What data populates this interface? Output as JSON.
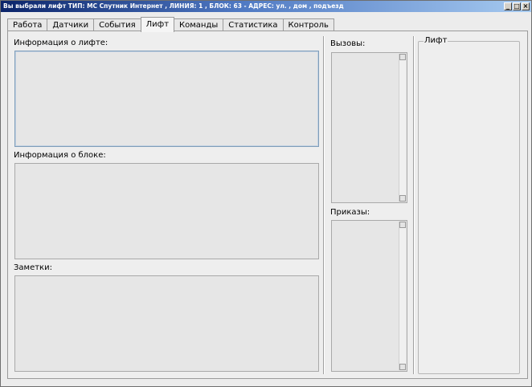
{
  "window": {
    "title": "Вы выбрали лифт  ТИП: МС Спутник Интернет , ЛИНИЯ: 1 , БЛОК: 63 - АДРЕС: ул. , дом , подъезд",
    "minimize_icon": "minimize-icon",
    "maximize_icon": "maximize-icon",
    "close_icon": "close-icon"
  },
  "tabs": [
    {
      "label": "Работа"
    },
    {
      "label": "Датчики"
    },
    {
      "label": "События"
    },
    {
      "label": "Лифт",
      "active": true
    },
    {
      "label": "Команды"
    },
    {
      "label": "Статистика"
    },
    {
      "label": "Контроль"
    }
  ],
  "panel": {
    "lift_info_label": "Информация о лифте:",
    "block_info_label": "Информация о блоке:",
    "notes_label": "Заметки:",
    "calls_label": "Вызовы:",
    "orders_label": "Приказы:",
    "lift_group_label": "Лифт"
  }
}
